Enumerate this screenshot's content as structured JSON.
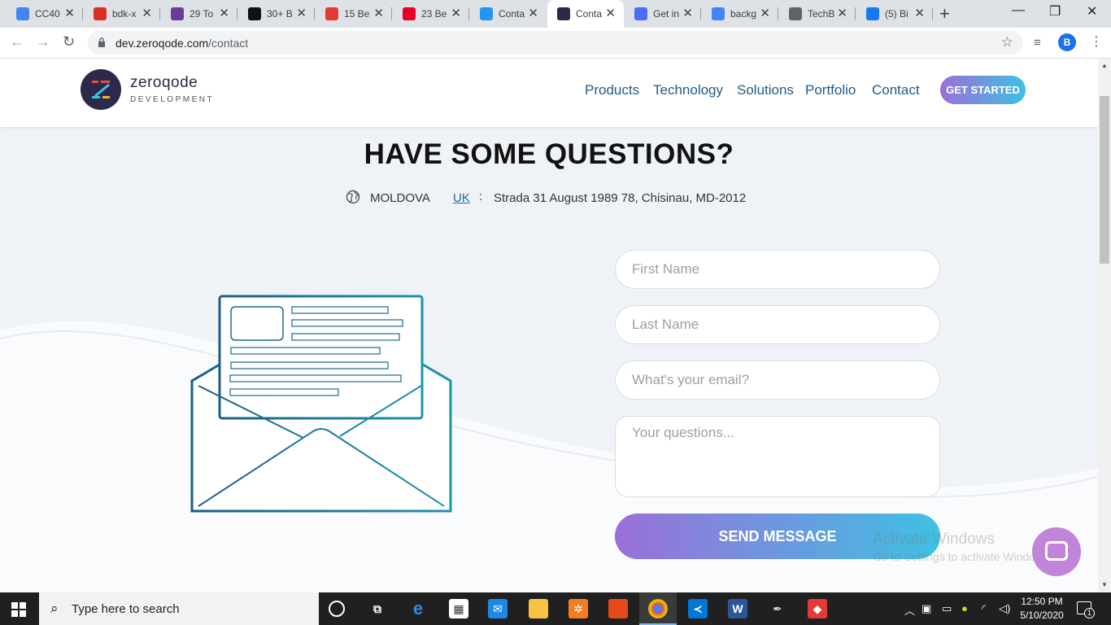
{
  "browser": {
    "tabs": [
      {
        "title": "CC40",
        "favicon": "google-docs-icon",
        "color": "#4285f4"
      },
      {
        "title": "bdk-x",
        "favicon": "clapper-icon",
        "color": "#d93025"
      },
      {
        "title": "29 To",
        "favicon": "colorlib-icon",
        "color": "#6a3d9a"
      },
      {
        "title": "30+ B",
        "favicon": "dm-icon",
        "color": "#111111"
      },
      {
        "title": "15 Be",
        "favicon": "b-icon",
        "color": "#e53935"
      },
      {
        "title": "23 Be",
        "favicon": "pinterest-icon",
        "color": "#e60023"
      },
      {
        "title": "Conta",
        "favicon": "bird-icon",
        "color": "#2196f3"
      },
      {
        "title": "Conta",
        "favicon": "zeroqode-icon",
        "color": "#2c2a4a"
      },
      {
        "title": "Get in",
        "favicon": "chat-icon",
        "color": "#4a6cf7"
      },
      {
        "title": "backg",
        "favicon": "google-icon",
        "color": "#4285f4"
      },
      {
        "title": "TechB",
        "favicon": "globe-icon",
        "color": "#5f6368"
      },
      {
        "title": "(5) Bi",
        "favicon": "facebook-icon",
        "color": "#1877f2"
      }
    ],
    "active_tab_index": 7,
    "url_host": "dev.zeroqode.com",
    "url_path": "/contact",
    "profile_initial": "B"
  },
  "site": {
    "logo_name": "zeroqode",
    "logo_sub": "DEVELOPMENT",
    "nav": [
      "Products",
      "Technology",
      "Solutions",
      "Portfolio",
      "Contact"
    ],
    "cta": "GET STARTED",
    "accent": "#1f5b8a"
  },
  "contact": {
    "headline": "HAVE SOME QUESTIONS?",
    "country": "MOLDOVA",
    "alt_country": "UK",
    "separator": ":",
    "address": "Strada 31 August 1989 78, Chisinau, MD-2012",
    "form": {
      "first_name_placeholder": "First Name",
      "last_name_placeholder": "Last Name",
      "email_placeholder": "What's your email?",
      "questions_placeholder": "Your questions...",
      "submit": "SEND MESSAGE"
    }
  },
  "overlay": {
    "activate_title": "Activate Windows",
    "activate_sub": "Go to Settings to activate Windows."
  },
  "taskbar": {
    "search_placeholder": "Type here to search",
    "time": "12:50 PM",
    "date": "5/10/2020",
    "notification_count": "1"
  }
}
